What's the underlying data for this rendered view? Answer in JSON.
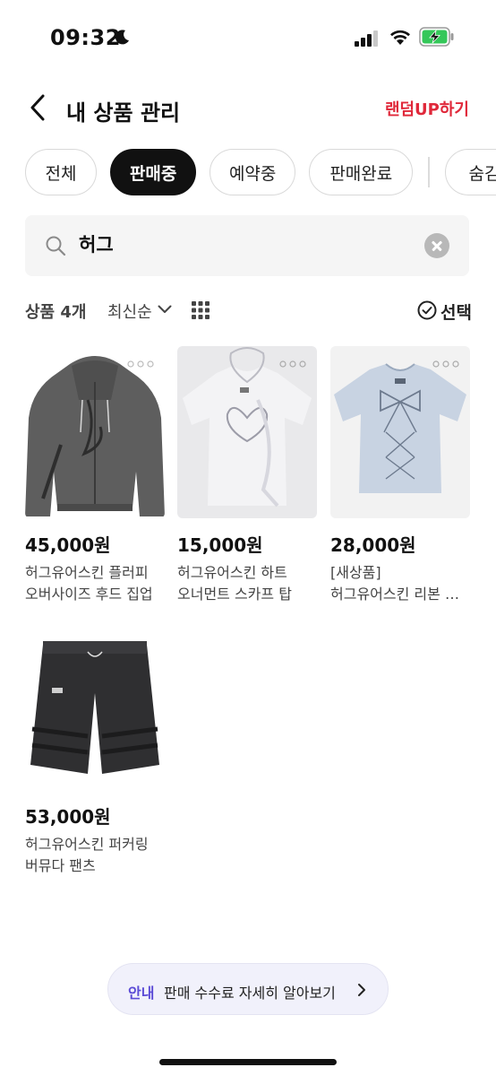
{
  "status_bar": {
    "time": "09:32"
  },
  "header": {
    "title": "내 상품 관리",
    "random_up_label": "랜덤UP하기"
  },
  "filters": {
    "tabs": [
      "전체",
      "판매중",
      "예약중",
      "판매완료",
      "숨김"
    ],
    "active": "판매중"
  },
  "search": {
    "value": "허그"
  },
  "toolbar": {
    "count_label": "상품 4개",
    "sort_label": "최신순",
    "select_label": "선택"
  },
  "products": [
    {
      "price": "45,000원",
      "name_line1": "허그유어스킨 플러피",
      "name_line2": "오버사이즈 후드 집업",
      "image": "gray-zip-hoodie"
    },
    {
      "price": "15,000원",
      "name_line1": "허그유어스킨 하트",
      "name_line2": "오너먼트 스카프 탑",
      "image": "white-heart-scarf-top"
    },
    {
      "price": "28,000원",
      "name_line1": "[새상품]",
      "name_line2": "허그유어스킨 리본 티셔츠",
      "image": "light-blue-ribbon-tee"
    },
    {
      "price": "53,000원",
      "name_line1": "허그유어스킨 퍼커링",
      "name_line2": "버뮤다 팬츠",
      "image": "black-bermuda-pants"
    }
  ],
  "notice": {
    "tag": "안내",
    "text": "판매 수수료 자세히 알아보기"
  },
  "colors": {
    "accent_red": "#e0283a",
    "notice_tag": "#5b4bd6",
    "active_chip": "#111111"
  }
}
